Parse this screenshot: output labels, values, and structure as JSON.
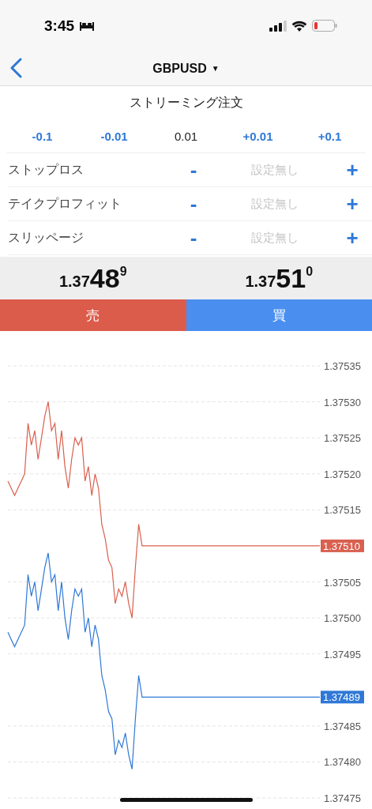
{
  "status_bar": {
    "time": "3:45"
  },
  "nav": {
    "title": "GBPUSD",
    "caret": "▼"
  },
  "section_title": "ストリーミング注文",
  "lot_steps": [
    {
      "label": "-0.1",
      "kind": "step"
    },
    {
      "label": "-0.01",
      "kind": "step"
    },
    {
      "label": "0.01",
      "kind": "value"
    },
    {
      "label": "+0.01",
      "kind": "step"
    },
    {
      "label": "+0.1",
      "kind": "step"
    }
  ],
  "params": [
    {
      "label": "ストップロス",
      "minus": "-",
      "value": "設定無し",
      "plus": "+"
    },
    {
      "label": "テイクプロフィット",
      "minus": "-",
      "value": "設定無し",
      "plus": "+"
    },
    {
      "label": "スリッページ",
      "minus": "-",
      "value": "設定無し",
      "plus": "+"
    }
  ],
  "prices": [
    {
      "prefix": "1.37",
      "big": "48",
      "sup": "9"
    },
    {
      "prefix": "1.37",
      "big": "51",
      "sup": "0"
    }
  ],
  "actions": [
    {
      "label": "売",
      "kind": "sell"
    },
    {
      "label": "買",
      "kind": "buy"
    }
  ],
  "chart": {
    "chart_data": {
      "type": "line",
      "grid": true,
      "ylim": [
        1.37475,
        1.37535
      ],
      "yticks": [
        1.37535,
        {
          "value": 1.3753,
          "label": "1.37530"
        },
        1.37525,
        {
          "value": 1.3752,
          "label": "1.37520"
        },
        1.37515,
        1.37505,
        {
          "value": 1.375,
          "label": "1.37500"
        },
        1.37495,
        1.37485,
        {
          "value": 1.3748,
          "label": "1.37480"
        },
        1.37475
      ],
      "categories": [
        null,
        null,
        null,
        null,
        null,
        null,
        null,
        null,
        null,
        null,
        null,
        null,
        null,
        null,
        null,
        null,
        null,
        null,
        null,
        null,
        null,
        null,
        null,
        null,
        null,
        null,
        null,
        null,
        null,
        null,
        null,
        null,
        null,
        null,
        null,
        null,
        null,
        null,
        null,
        null,
        null,
        null,
        null,
        null,
        null,
        null,
        null,
        null,
        null,
        null,
        null,
        null,
        null,
        null,
        null,
        null,
        null,
        null,
        null,
        null,
        null,
        null,
        null,
        null,
        null,
        null,
        null,
        null,
        null,
        null,
        null,
        null,
        null,
        null,
        null,
        null,
        null,
        null,
        null,
        null,
        null,
        null,
        null,
        null,
        null,
        null,
        null,
        null,
        null,
        null,
        null,
        null,
        null,
        null
      ],
      "series": [
        {
          "color": "#d9604f",
          "values": [
            1.37519,
            1.37518,
            1.37517,
            1.37518,
            1.37519,
            1.3752,
            1.37527,
            1.37524,
            1.37526,
            1.37522,
            1.37525,
            1.37528,
            1.3753,
            1.37526,
            1.37527,
            1.37522,
            1.37526,
            1.37521,
            1.37518,
            1.37522,
            1.37525,
            1.37524,
            1.37525,
            1.37519,
            1.37521,
            1.37517,
            1.3752,
            1.37518,
            1.37513,
            1.37511,
            1.37508,
            1.37507,
            1.37502,
            1.37504,
            1.37503,
            1.37505,
            1.37502,
            1.375,
            1.37507,
            1.37513,
            1.3751,
            1.3751,
            1.3751,
            1.3751,
            1.3751,
            1.3751,
            1.3751,
            1.3751,
            1.3751,
            1.3751,
            1.3751,
            1.3751,
            1.3751,
            1.3751,
            1.3751,
            1.3751,
            1.3751,
            1.3751,
            1.3751,
            1.3751,
            1.3751,
            1.3751,
            1.3751,
            1.3751,
            1.3751,
            1.3751,
            1.3751,
            1.3751,
            1.3751,
            1.3751,
            1.3751,
            1.3751,
            1.3751,
            1.3751,
            1.3751,
            1.3751,
            1.3751,
            1.3751,
            1.3751,
            1.3751,
            1.3751,
            1.3751,
            1.3751,
            1.3751,
            1.3751,
            1.3751,
            1.3751,
            1.3751,
            1.3751,
            1.3751,
            1.3751,
            1.3751,
            1.3751,
            1.3751
          ]
        },
        {
          "color": "#2f78d6",
          "values": [
            1.37498,
            1.37497,
            1.37496,
            1.37497,
            1.37498,
            1.37499,
            1.37506,
            1.37503,
            1.37505,
            1.37501,
            1.37504,
            1.37507,
            1.37509,
            1.37505,
            1.37506,
            1.37501,
            1.37505,
            1.375,
            1.37497,
            1.37501,
            1.37504,
            1.37503,
            1.37504,
            1.37498,
            1.375,
            1.37496,
            1.37499,
            1.37497,
            1.37492,
            1.3749,
            1.37487,
            1.37486,
            1.37481,
            1.37483,
            1.37482,
            1.37484,
            1.37481,
            1.37479,
            1.37486,
            1.37492,
            1.37489,
            1.37489,
            1.37489,
            1.37489,
            1.37489,
            1.37489,
            1.37489,
            1.37489,
            1.37489,
            1.37489,
            1.37489,
            1.37489,
            1.37489,
            1.37489,
            1.37489,
            1.37489,
            1.37489,
            1.37489,
            1.37489,
            1.37489,
            1.37489,
            1.37489,
            1.37489,
            1.37489,
            1.37489,
            1.37489,
            1.37489,
            1.37489,
            1.37489,
            1.37489,
            1.37489,
            1.37489,
            1.37489,
            1.37489,
            1.37489,
            1.37489,
            1.37489,
            1.37489,
            1.37489,
            1.37489,
            1.37489,
            1.37489,
            1.37489,
            1.37489,
            1.37489,
            1.37489,
            1.37489,
            1.37489,
            1.37489,
            1.37489,
            1.37489,
            1.37489,
            1.37489,
            1.37489
          ]
        }
      ],
      "annotations": [
        "1.37510",
        "1.37489"
      ]
    }
  }
}
